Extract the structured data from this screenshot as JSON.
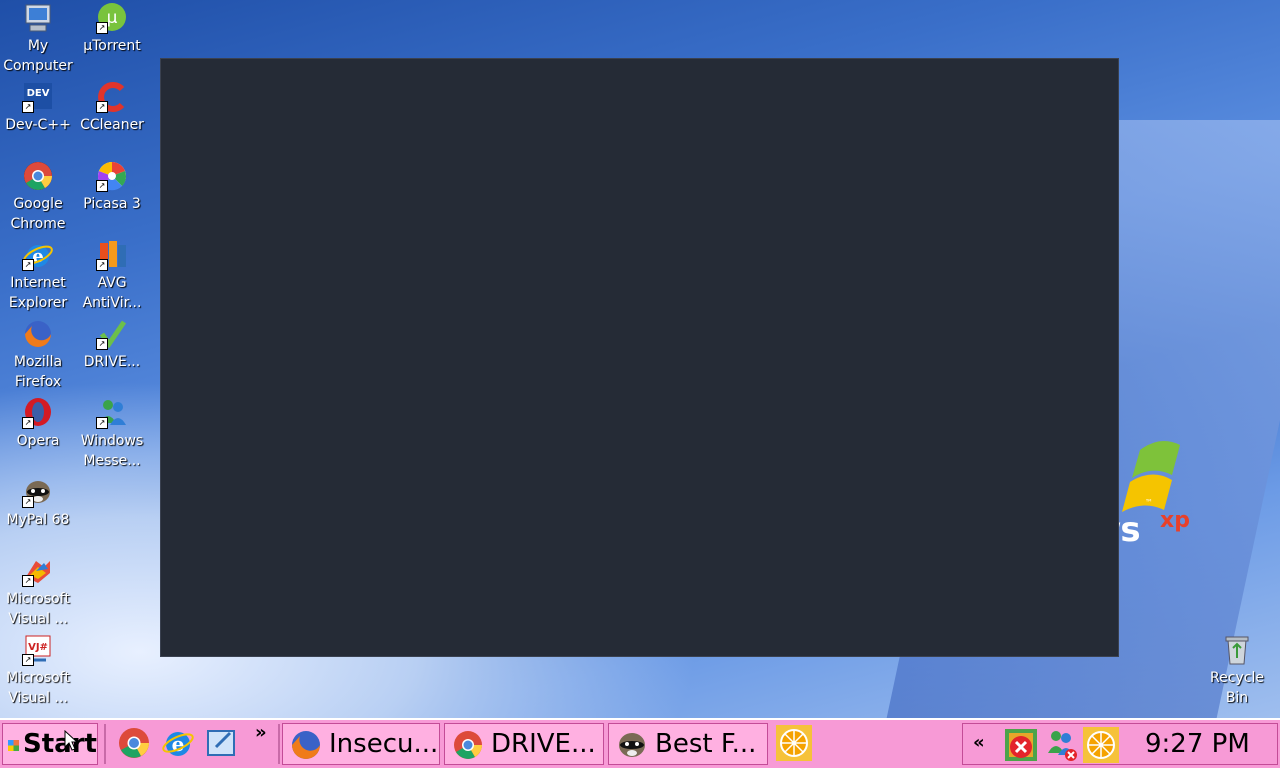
{
  "desktop": {
    "icons": [
      {
        "label": "My Computer",
        "icon": "my-computer-icon"
      },
      {
        "label": "µTorrent",
        "icon": "utorrent-icon"
      },
      {
        "label": "Dev-C++",
        "icon": "devcpp-icon"
      },
      {
        "label": "CCleaner",
        "icon": "ccleaner-icon"
      },
      {
        "label": "Google Chrome",
        "icon": "chrome-icon"
      },
      {
        "label": "Picasa 3",
        "icon": "picasa-icon"
      },
      {
        "label": "Internet Explorer",
        "icon": "ie-icon"
      },
      {
        "label": "AVG AntiVir...",
        "icon": "avg-icon"
      },
      {
        "label": "Mozilla Firefox",
        "icon": "firefox-icon"
      },
      {
        "label": "DRIVE...",
        "icon": "drive-icon"
      },
      {
        "label": "Opera",
        "icon": "opera-icon"
      },
      {
        "label": "Windows Messe...",
        "icon": "messenger-icon"
      },
      {
        "label": "MyPal 68",
        "icon": "mypal-icon"
      },
      {
        "label": "Microsoft Visual ...",
        "icon": "visual-studio-icon"
      },
      {
        "label": "Microsoft Visual ...",
        "icon": "visual-jsharp-icon"
      },
      {
        "label": "Recycle Bin",
        "icon": "recycle-bin-icon"
      }
    ],
    "xp_logo": {
      "word": "ws",
      "sup": "xp",
      "tm": "™"
    }
  },
  "taskbar": {
    "start_label": "Start",
    "quick_launch_more": "»",
    "tasks": [
      {
        "label": "Insecu...",
        "icon": "firefox-icon"
      },
      {
        "label": "DRIVE...",
        "icon": "chrome-icon"
      },
      {
        "label": "Best F...",
        "icon": "mypal-icon"
      }
    ],
    "tray_expand": "«",
    "clock": "9:27 PM"
  }
}
